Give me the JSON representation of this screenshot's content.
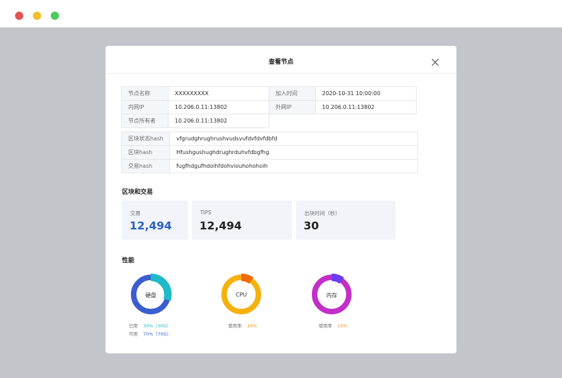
{
  "window": {
    "controls": [
      "close",
      "minimize",
      "maximize"
    ]
  },
  "modal": {
    "title": "查看节点"
  },
  "node_info": {
    "name_label": "节点名称",
    "name_value": "XXXXXXXXX",
    "join_time_label": "加入时间",
    "join_time_value": "2020-10-31 10:00:00",
    "internal_ip_label": "内网IP",
    "internal_ip_value": "10.206.0.11:13802",
    "external_ip_label": "外网IP",
    "external_ip_value": "10.206.0.11:13802",
    "owner_label": "节点所有者",
    "owner_value": "10.206.0.11:13802"
  },
  "hashes": [
    {
      "label": "区块状态hash",
      "value": "vfgrudghrughrushvudsvufdvfdvfdbfd"
    },
    {
      "label": "区块hash",
      "value": "Hfushgushughdrughrduhvfdbgfhg"
    },
    {
      "label": "交易hash",
      "value": "fugfhdgufhdoihfdohviouhohohoih"
    }
  ],
  "blocks_section": {
    "title": "区块和交易",
    "cards": [
      {
        "label": "交易",
        "value": "12,494"
      },
      {
        "label": "TIPS",
        "value": "12,494"
      },
      {
        "label": "出块时间（秒）",
        "value": "30"
      }
    ]
  },
  "performance": {
    "title": "性能",
    "disk": {
      "label": "硬盘",
      "used_fraction": 0.3,
      "used_label": "已用",
      "used_value": "30%（30G）",
      "free_label": "可用",
      "free_value": "70%（70G）",
      "used_color": "#1fbac8",
      "free_color": "#3a5ed0"
    },
    "cpu": {
      "label": "CPU",
      "used_fraction": 0.1,
      "usage_label": "使用率",
      "usage_value": "10%",
      "ring_color": "#f5b10c",
      "used_color": "#f26a0a"
    },
    "memory": {
      "label": "内存",
      "used_fraction": 0.1,
      "usage_label": "使用率",
      "usage_value": "10%",
      "ring_color": "#c22fc8",
      "used_color": "#6a3ef0"
    }
  },
  "colors": {
    "accent_blue": "#2a5fc4",
    "percent_orange": "#f2891a",
    "card_bg": "#f2f4fa"
  },
  "icons": {
    "close": "close-icon"
  }
}
